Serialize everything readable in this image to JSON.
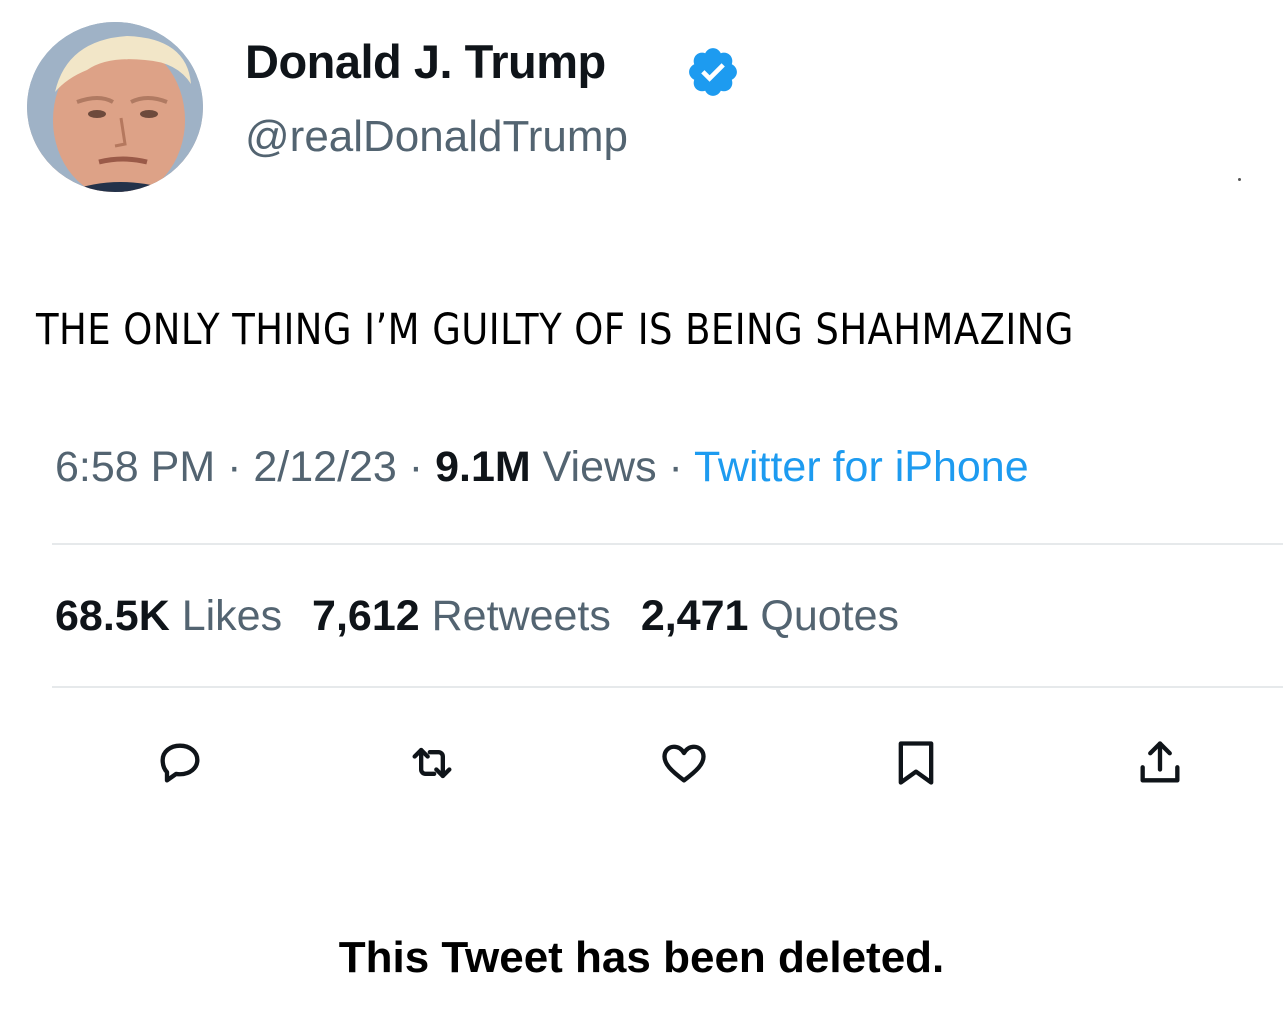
{
  "tweet": {
    "author": {
      "name": "Donald J. Trump",
      "handle": "@realDonaldTrump",
      "verified": true,
      "avatar_icon": "profile-photo"
    },
    "text": "THE ONLY THING I’M GUILTY OF IS BEING SHAHMAZING",
    "meta": {
      "time": "6:58 PM",
      "separator": "·",
      "date": "2/12/23",
      "views_count": "9.1M",
      "views_label": "Views",
      "source": "Twitter for iPhone"
    },
    "stats": {
      "likes_count": "68.5K",
      "likes_label": "Likes",
      "retweets_count": "7,612",
      "retweets_label": "Retweets",
      "quotes_count": "2,471",
      "quotes_label": "Quotes"
    },
    "actions": [
      {
        "icon": "reply-icon"
      },
      {
        "icon": "retweet-icon"
      },
      {
        "icon": "like-icon"
      },
      {
        "icon": "bookmark-icon"
      },
      {
        "icon": "share-icon"
      }
    ],
    "deleted_notice": "This Tweet has been deleted."
  },
  "colors": {
    "text_primary": "#0f1419",
    "text_secondary": "#536471",
    "link_blue": "#1d9bf0",
    "divider": "#e6e9eb",
    "background": "#ffffff"
  }
}
